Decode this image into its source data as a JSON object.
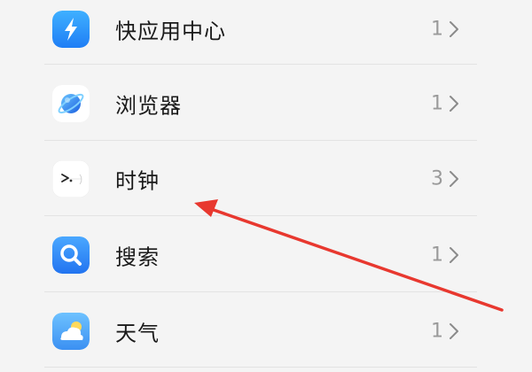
{
  "settings_list": {
    "items": [
      {
        "label": "快应用中心",
        "count": "1",
        "icon": "quick-app-bolt-icon"
      },
      {
        "label": "浏览器",
        "count": "1",
        "icon": "browser-globe-icon"
      },
      {
        "label": "时钟",
        "count": "3",
        "icon": "clock-icon"
      },
      {
        "label": "搜索",
        "count": "1",
        "icon": "search-magnifier-icon"
      },
      {
        "label": "天气",
        "count": "1",
        "icon": "weather-cloud-icon"
      }
    ]
  },
  "colors": {
    "background": "#f4f4f4",
    "divider": "#e3e3e3",
    "annotation_arrow": "#e8382f"
  }
}
